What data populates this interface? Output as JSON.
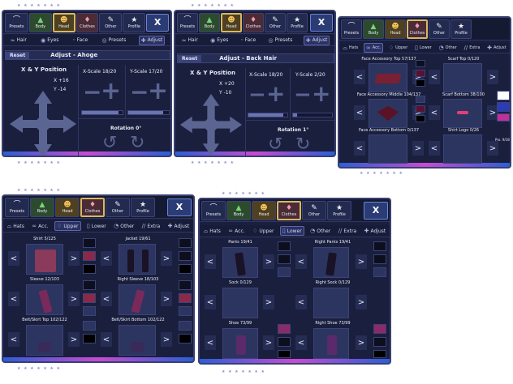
{
  "topnav": {
    "presets": "Presets",
    "body": "Body",
    "head": "Head",
    "clothes": "Clothes",
    "other": "Other",
    "profile": "Profile",
    "close": "X"
  },
  "icons": {
    "presets": "hanger-icon",
    "body": "shirt-body-icon",
    "head": "head-icon",
    "clothes": "shirt-icon",
    "other": "cat-icon",
    "profile": "star-list-icon"
  },
  "head_tabs": {
    "hair": "Hair",
    "eyes": "Eyes",
    "face": "Face",
    "presets": "Presets",
    "adjust": "Adjust"
  },
  "clothes_tabs": {
    "hats": "Hats",
    "acc": "Acc.",
    "upper": "Upper",
    "lower": "Lower",
    "other": "Other",
    "extra": "Extra",
    "adjust": "Adjust"
  },
  "stars": "★ ★ ★ ★ ★ ★ ★",
  "p1": {
    "reset": "Reset",
    "title": "Adjust - Ahoge",
    "xy": "X & Y Position",
    "x": "X +16",
    "y": "Y -14",
    "xscale": "X-Scale 18/20",
    "yscale": "Y-Scale 17/20",
    "rotation": "Rotation 0°",
    "xscale_level": 0.9,
    "yscale_level": 0.85
  },
  "p2": {
    "reset": "Reset",
    "title": "Adjust - Back Hair",
    "xy": "X & Y Position",
    "x": "X +20",
    "y": "Y -10",
    "xscale": "X-Scale 18/20",
    "yscale": "Y-Scale 2/20",
    "rotation": "Rotation 1°",
    "xscale_level": 0.9,
    "yscale_level": 0.1
  },
  "p3": {
    "cells": [
      {
        "title": "Face Accessory Top 57/137",
        "item": "face-accessory"
      },
      {
        "title": "Scarf Top 0/120",
        "item": ""
      },
      {
        "title": "Face Accessory Middle 104/137",
        "item": "face-accessory"
      },
      {
        "title": "Scarf Bottom 38/100",
        "item": "scarf"
      },
      {
        "title": "Face Accessory Bottom 0/137",
        "item": ""
      },
      {
        "title": "Shirt Logo 0/26",
        "item": ""
      }
    ],
    "pro": "Pro. 9/18"
  },
  "p4": {
    "cells": [
      {
        "title": "Shirt 5/125",
        "item": "shirt"
      },
      {
        "title": "Jacket 19/61",
        "item": "jacket"
      },
      {
        "title": "Sleeve 12/103",
        "item": "sleeve"
      },
      {
        "title": "Right Sleeve 18/103",
        "item": "sleeve"
      },
      {
        "title": "Belt/Skirt Top 102/122",
        "item": "belt"
      },
      {
        "title": "Belt/Skirt Bottom 102/122",
        "item": "belt"
      }
    ]
  },
  "p5": {
    "cells": [
      {
        "title": "Pants 19/41",
        "item": "pants"
      },
      {
        "title": "Right Pants 19/41",
        "item": "pants"
      },
      {
        "title": "Sock 0/129",
        "item": ""
      },
      {
        "title": "Right Sock 0/129",
        "item": ""
      },
      {
        "title": "Shoe 73/99",
        "item": "shoe"
      },
      {
        "title": "Right Shoe 73/99",
        "item": "shoe"
      }
    ]
  },
  "arrows": {
    "left": "<",
    "right": ">"
  },
  "colors": {
    "panel": "#1a1f3d",
    "accent_pink": "#c84bd0",
    "accent_blue": "#2a5fd8",
    "item_dark": "#1a1226",
    "item_red": "#7a2033",
    "item_purple": "#5a2a6a"
  }
}
